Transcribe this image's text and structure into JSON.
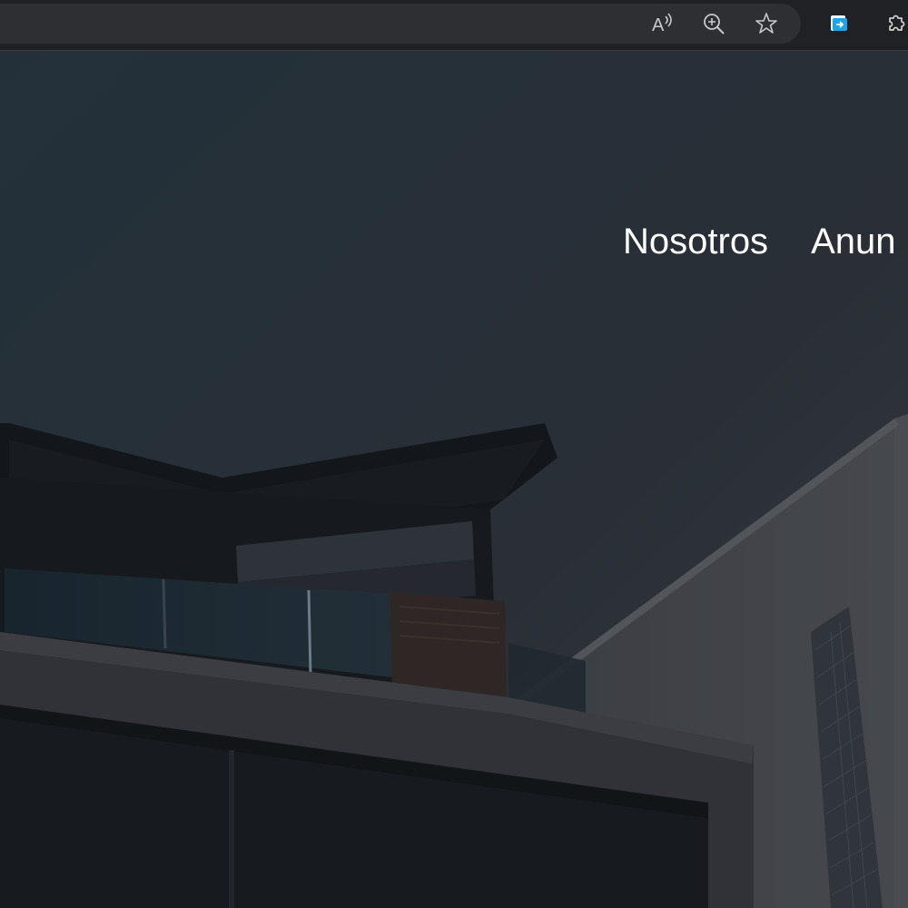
{
  "browser": {
    "toolbar_icons": [
      {
        "name": "read-aloud-icon"
      },
      {
        "name": "zoom-in-icon"
      },
      {
        "name": "favorite-star-icon"
      },
      {
        "name": "collections-icon"
      },
      {
        "name": "extensions-icon"
      }
    ]
  },
  "hero": {
    "nav": {
      "items": [
        {
          "label": "Nosotros"
        },
        {
          "label": "Anun"
        }
      ]
    }
  }
}
